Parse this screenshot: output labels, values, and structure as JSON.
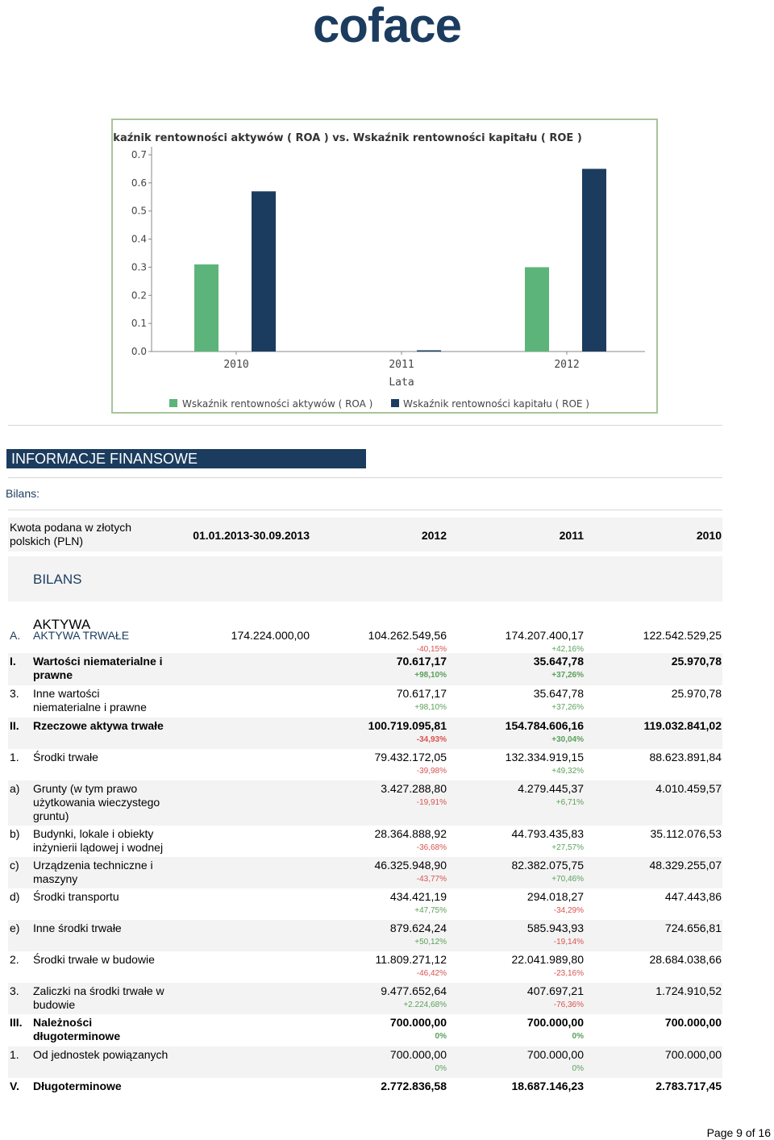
{
  "brand": {
    "logo_text": "coface",
    "color_primary": "#1b3c5e",
    "color_accent": "#2aa5b8"
  },
  "chart_data": {
    "type": "bar",
    "title": "Wskaźnik rentowności aktywów ( ROA ) vs. Wskaźnik rentowności kapitału ( ROE )",
    "xlabel": "Lata",
    "ylabel": "",
    "categories": [
      "2010",
      "2011",
      "2012"
    ],
    "ylim": [
      0,
      0.7
    ],
    "yticks": [
      "0.0",
      "0.1",
      "0.2",
      "0.3",
      "0.4",
      "0.5",
      "0.6",
      "0.7"
    ],
    "grid": false,
    "legend_position": "bottom",
    "series": [
      {
        "name": "Wskaźnik rentowności aktywów ( ROA )",
        "color": "#5db47a",
        "values": [
          0.31,
          0.0,
          0.3
        ]
      },
      {
        "name": "Wskaźnik rentowności kapitału ( ROE )",
        "color": "#1b3c5e",
        "values": [
          0.57,
          0.004,
          0.65
        ]
      }
    ]
  },
  "section": {
    "title": "INFORMACJE FINANSOWE",
    "subtitle": "Bilans:"
  },
  "table": {
    "header": {
      "desc": "Kwota podana w złotych polskich (PLN)",
      "cols": [
        "01.01.2013-30.09.2013",
        "2012",
        "2011",
        "2010"
      ]
    },
    "group_bilans": "BILANS",
    "group_aktywa": "AKTYWA",
    "rows": [
      {
        "num": "A.",
        "label": "AKTYWA TRWAŁE",
        "style": "blue",
        "alt": false,
        "h": 32,
        "v0": "174.224.000,00",
        "v1": "104.262.549,56",
        "p1": "-40,15%",
        "v2": "174.207.400,17",
        "p2": "+42,16%",
        "v3": "122.542.529,25"
      },
      {
        "num": "I.",
        "label": "Wartości niematerialne i prawne",
        "style": "bold",
        "alt": true,
        "h": 40,
        "v0": "",
        "v1": "70.617,17",
        "p1": "+98,10%",
        "v2": "35.647,78",
        "p2": "+37,26%",
        "v3": "25.970,78"
      },
      {
        "num": "3.",
        "label": "Inne wartości niematerialne i prawne",
        "style": "",
        "alt": false,
        "h": 40,
        "v0": "",
        "v1": "70.617,17",
        "p1": "+98,10%",
        "v2": "35.647,78",
        "p2": "+37,26%",
        "v3": "25.970,78"
      },
      {
        "num": "II.",
        "label": "Rzeczowe aktywa trwałe",
        "style": "bold",
        "alt": true,
        "h": 39,
        "v0": "",
        "v1": "100.719.095,81",
        "p1": "-34,93%",
        "v2": "154.784.606,16",
        "p2": "+30,04%",
        "v3": "119.032.841,02"
      },
      {
        "num": "1.",
        "label": "Środki trwałe",
        "style": "",
        "alt": false,
        "h": 39,
        "v0": "",
        "v1": "79.432.172,05",
        "p1": "-39,98%",
        "v2": "132.334.919,15",
        "p2": "+49,32%",
        "v3": "88.623.891,84"
      },
      {
        "num": "a)",
        "label": "Grunty (w tym prawo użytkowania wieczystego gruntu)",
        "style": "",
        "alt": true,
        "h": 56,
        "v0": "",
        "v1": "3.427.288,80",
        "p1": "-19,91%",
        "v2": "4.279.445,37",
        "p2": "+6,71%",
        "v3": "4.010.459,57"
      },
      {
        "num": "b)",
        "label": "Budynki, lokale i obiekty inżynierii lądowej i wodnej",
        "style": "",
        "alt": false,
        "h": 39,
        "v0": "",
        "v1": "28.364.888,92",
        "p1": "-36,68%",
        "v2": "44.793.435,83",
        "p2": "+27,57%",
        "v3": "35.112.076,53"
      },
      {
        "num": "c)",
        "label": "Urządzenia techniczne i maszyny",
        "style": "",
        "alt": true,
        "h": 39,
        "v0": "",
        "v1": "46.325.948,90",
        "p1": "-43,77%",
        "v2": "82.382.075,75",
        "p2": "+70,46%",
        "v3": "48.329.255,07"
      },
      {
        "num": "d)",
        "label": "Środki transportu",
        "style": "",
        "alt": false,
        "h": 39,
        "v0": "",
        "v1": "434.421,19",
        "p1": "+47,75%",
        "v2": "294.018,27",
        "p2": "-34,29%",
        "v3": "447.443,86"
      },
      {
        "num": "e)",
        "label": "Inne środki trwałe",
        "style": "",
        "alt": true,
        "h": 39,
        "v0": "",
        "v1": "879.624,24",
        "p1": "+50,12%",
        "v2": "585.943,93",
        "p2": "-19,14%",
        "v3": "724.656,81"
      },
      {
        "num": "2.",
        "label": "Środki trwałe w budowie",
        "style": "",
        "alt": false,
        "h": 39,
        "v0": "",
        "v1": "11.809.271,12",
        "p1": "-46,42%",
        "v2": "22.041.989,80",
        "p2": "-23,16%",
        "v3": "28.684.038,66"
      },
      {
        "num": "3.",
        "label": "Zaliczki na środki trwałe w budowie",
        "style": "",
        "alt": true,
        "h": 39,
        "v0": "",
        "v1": "9.477.652,64",
        "p1": "+2.224,68%",
        "v2": "407.697,21",
        "p2": "-76,36%",
        "v3": "1.724.910,52"
      },
      {
        "num": "III.",
        "label": "Należności długoterminowe",
        "style": "bold",
        "alt": false,
        "h": 40,
        "v0": "",
        "v1": "700.000,00",
        "p1": "0%",
        "v2": "700.000,00",
        "p2": "0%",
        "v3": "700.000,00"
      },
      {
        "num": "1.",
        "label": "Od jednostek powiązanych",
        "style": "",
        "alt": true,
        "h": 39,
        "v0": "",
        "v1": "700.000,00",
        "p1": "0%",
        "v2": "700.000,00",
        "p2": "0%",
        "v3": "700.000,00"
      },
      {
        "num": "V.",
        "label": "Długoterminowe",
        "style": "bold",
        "alt": false,
        "h": 28,
        "v0": "",
        "v1": "2.772.836,58",
        "p1": "",
        "v2": "18.687.146,23",
        "p2": "",
        "v3": "2.783.717,45"
      }
    ]
  },
  "footer": {
    "page": "Page 9 of 16"
  }
}
